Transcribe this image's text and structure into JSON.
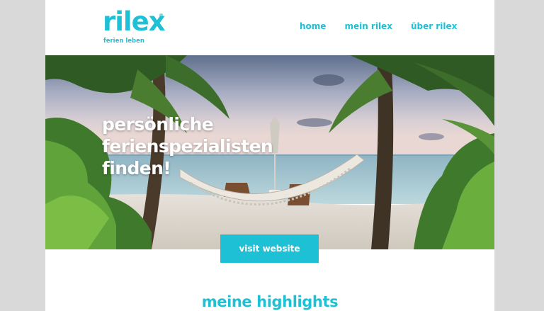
{
  "header": {
    "logo_text": "rilex",
    "logo_mark": "®",
    "tagline": "ferien leben",
    "nav": [
      {
        "label": "home"
      },
      {
        "label": "mein rilex"
      },
      {
        "label": "über rilex"
      }
    ]
  },
  "hero": {
    "headline_lines": [
      "persönliche",
      "ferienspezialisten",
      "finden!"
    ],
    "image_icon": "beach-hammock-photo"
  },
  "cta": {
    "label": "visit website"
  },
  "highlights": {
    "title": "meine highlights"
  },
  "colors": {
    "accent": "#1ec0d6",
    "background": "#d9d9d9"
  }
}
